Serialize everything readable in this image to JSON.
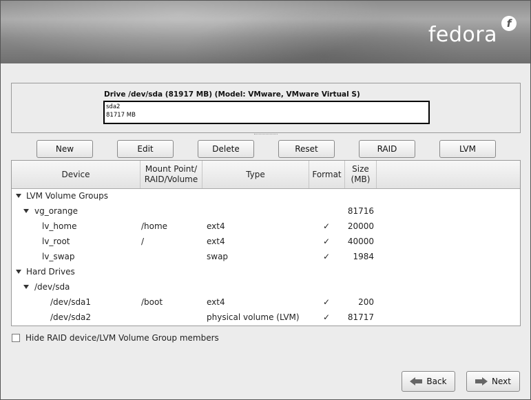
{
  "banner": {
    "logo_text": "fedora",
    "logo_mark": "f"
  },
  "drive": {
    "title": "Drive /dev/sda (81917 MB) (Model: VMware, VMware Virtual S)",
    "segment_name": "sda2",
    "segment_size": "81717 MB"
  },
  "toolbar": {
    "new": "New",
    "edit": "Edit",
    "delete": "Delete",
    "reset": "Reset",
    "raid": "RAID",
    "lvm": "LVM"
  },
  "table": {
    "headers": {
      "device": "Device",
      "mount": "Mount Point/ RAID/Volume",
      "type": "Type",
      "format": "Format",
      "size": "Size (MB)"
    },
    "rows": [
      {
        "device": "LVM Volume Groups",
        "mount": "",
        "type": "",
        "format": "",
        "size": ""
      },
      {
        "device": "vg_orange",
        "mount": "",
        "type": "",
        "format": "",
        "size": "81716"
      },
      {
        "device": "lv_home",
        "mount": "/home",
        "type": "ext4",
        "format": "✓",
        "size": "20000"
      },
      {
        "device": "lv_root",
        "mount": "/",
        "type": "ext4",
        "format": "✓",
        "size": "40000"
      },
      {
        "device": "lv_swap",
        "mount": "",
        "type": "swap",
        "format": "✓",
        "size": "1984"
      },
      {
        "device": "Hard Drives",
        "mount": "",
        "type": "",
        "format": "",
        "size": ""
      },
      {
        "device": "/dev/sda",
        "mount": "",
        "type": "",
        "format": "",
        "size": ""
      },
      {
        "device": "/dev/sda1",
        "mount": "/boot",
        "type": "ext4",
        "format": "✓",
        "size": "200"
      },
      {
        "device": "/dev/sda2",
        "mount": "",
        "type": "physical volume (LVM)",
        "format": "✓",
        "size": "81717"
      }
    ]
  },
  "options": {
    "hide_members": "Hide RAID device/LVM Volume Group members",
    "hide_members_checked": false
  },
  "nav": {
    "back": "Back",
    "next": "Next"
  }
}
